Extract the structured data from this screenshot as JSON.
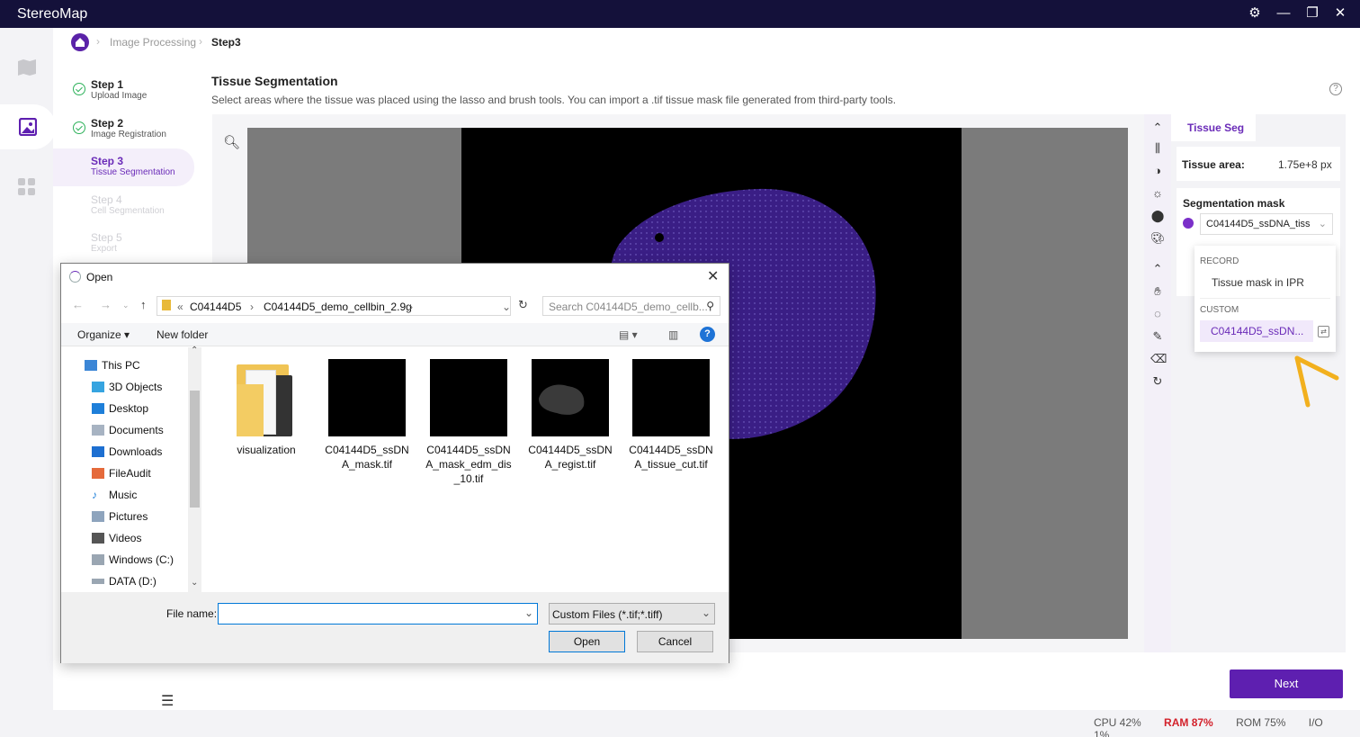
{
  "app": {
    "title": "StereoMap"
  },
  "breadcrumb": {
    "items": [
      "Image Processing",
      "Step3"
    ]
  },
  "steps": [
    {
      "title": "Step 1",
      "subtitle": "Upload Image",
      "state": "done"
    },
    {
      "title": "Step 2",
      "subtitle": "Image Registration",
      "state": "done"
    },
    {
      "title": "Step 3",
      "subtitle": "Tissue Segmentation",
      "state": "active"
    },
    {
      "title": "Step 4",
      "subtitle": "Cell Segmentation",
      "state": "disabled"
    },
    {
      "title": "Step 5",
      "subtitle": "Export",
      "state": "disabled"
    }
  ],
  "main": {
    "title": "Tissue Segmentation",
    "subtitle": "Select areas where the tissue was placed using the lasso and brush tools. You can import a .tif tissue mask file generated from third-party tools."
  },
  "right_panel": {
    "tab": "Tissue Seg",
    "tissue_area_label": "Tissue area:",
    "tissue_area_value": "1.75e+8 px",
    "mask_label": "Segmentation mask",
    "mask_selected": "C04144D5_ssDNA_tiss",
    "mask_color": "#7b2fc9"
  },
  "dropdown": {
    "section_record": "RECORD",
    "record_item": "Tissue mask in IPR",
    "section_custom": "CUSTOM",
    "custom_item": "C04144D5_ssDN..."
  },
  "next_button": "Next",
  "status": {
    "cpu": "CPU  42%",
    "ram": "RAM  87%",
    "rom": "ROM  75%",
    "io": "I/O  1%"
  },
  "dialog": {
    "title": "Open",
    "path": [
      "C04144D5",
      "C04144D5_demo_cellbin_2.9g"
    ],
    "search_placeholder": "Search C04144D5_demo_cellb...",
    "organize": "Organize ▾",
    "new_folder": "New folder",
    "tree": [
      "This PC",
      "3D Objects",
      "Desktop",
      "Documents",
      "Downloads",
      "FileAudit",
      "Music",
      "Pictures",
      "Videos",
      "Windows (C:)",
      "DATA (D:)"
    ],
    "files": [
      {
        "name": "visualization",
        "kind": "folder"
      },
      {
        "name": "C04144D5_ssDNA_mask.tif",
        "kind": "image"
      },
      {
        "name": "C04144D5_ssDNA_mask_edm_dis_10.tif",
        "kind": "image"
      },
      {
        "name": "C04144D5_ssDNA_regist.tif",
        "kind": "image-tissue"
      },
      {
        "name": "C04144D5_ssDNA_tissue_cut.tif",
        "kind": "image"
      }
    ],
    "file_name_label": "File name:",
    "file_name_value": "",
    "file_type": "Custom Files (*.tif;*.tiff)",
    "open_button": "Open",
    "cancel_button": "Cancel"
  },
  "colors": {
    "accent": "#5e1fb0",
    "titlebar": "#14113a",
    "annotation_arrow": "#f2b01e"
  }
}
